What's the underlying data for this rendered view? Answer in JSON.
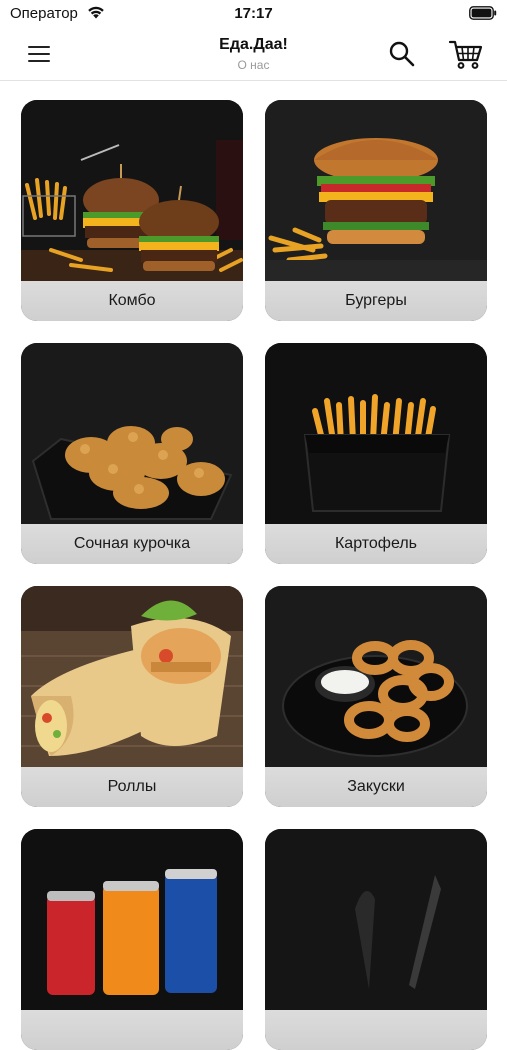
{
  "status_bar": {
    "carrier": "Оператор",
    "time": "17:17",
    "wifi_icon": "wifi-icon",
    "battery_icon": "battery-icon"
  },
  "header": {
    "title": "Еда.Даа!",
    "subtitle": "О нас",
    "menu_icon": "hamburger-menu-icon",
    "search_icon": "search-icon",
    "cart_icon": "cart-icon"
  },
  "categories": [
    {
      "label": "Комбо",
      "image": "combo-burgers-fries-photo"
    },
    {
      "label": "Бургеры",
      "image": "burger-photo"
    },
    {
      "label": "Сочная курочка",
      "image": "fried-chicken-photo"
    },
    {
      "label": "Картофель",
      "image": "french-fries-photo"
    },
    {
      "label": "Роллы",
      "image": "wrap-rolls-photo"
    },
    {
      "label": "Закуски",
      "image": "onion-rings-photo"
    },
    {
      "label": "",
      "image": "drinks-cans-photo"
    },
    {
      "label": "",
      "image": "dark-photo"
    }
  ],
  "colors": {
    "label_background": "#d4d4d4",
    "card_background": "#111111",
    "subtitle": "#9a9a9a"
  }
}
